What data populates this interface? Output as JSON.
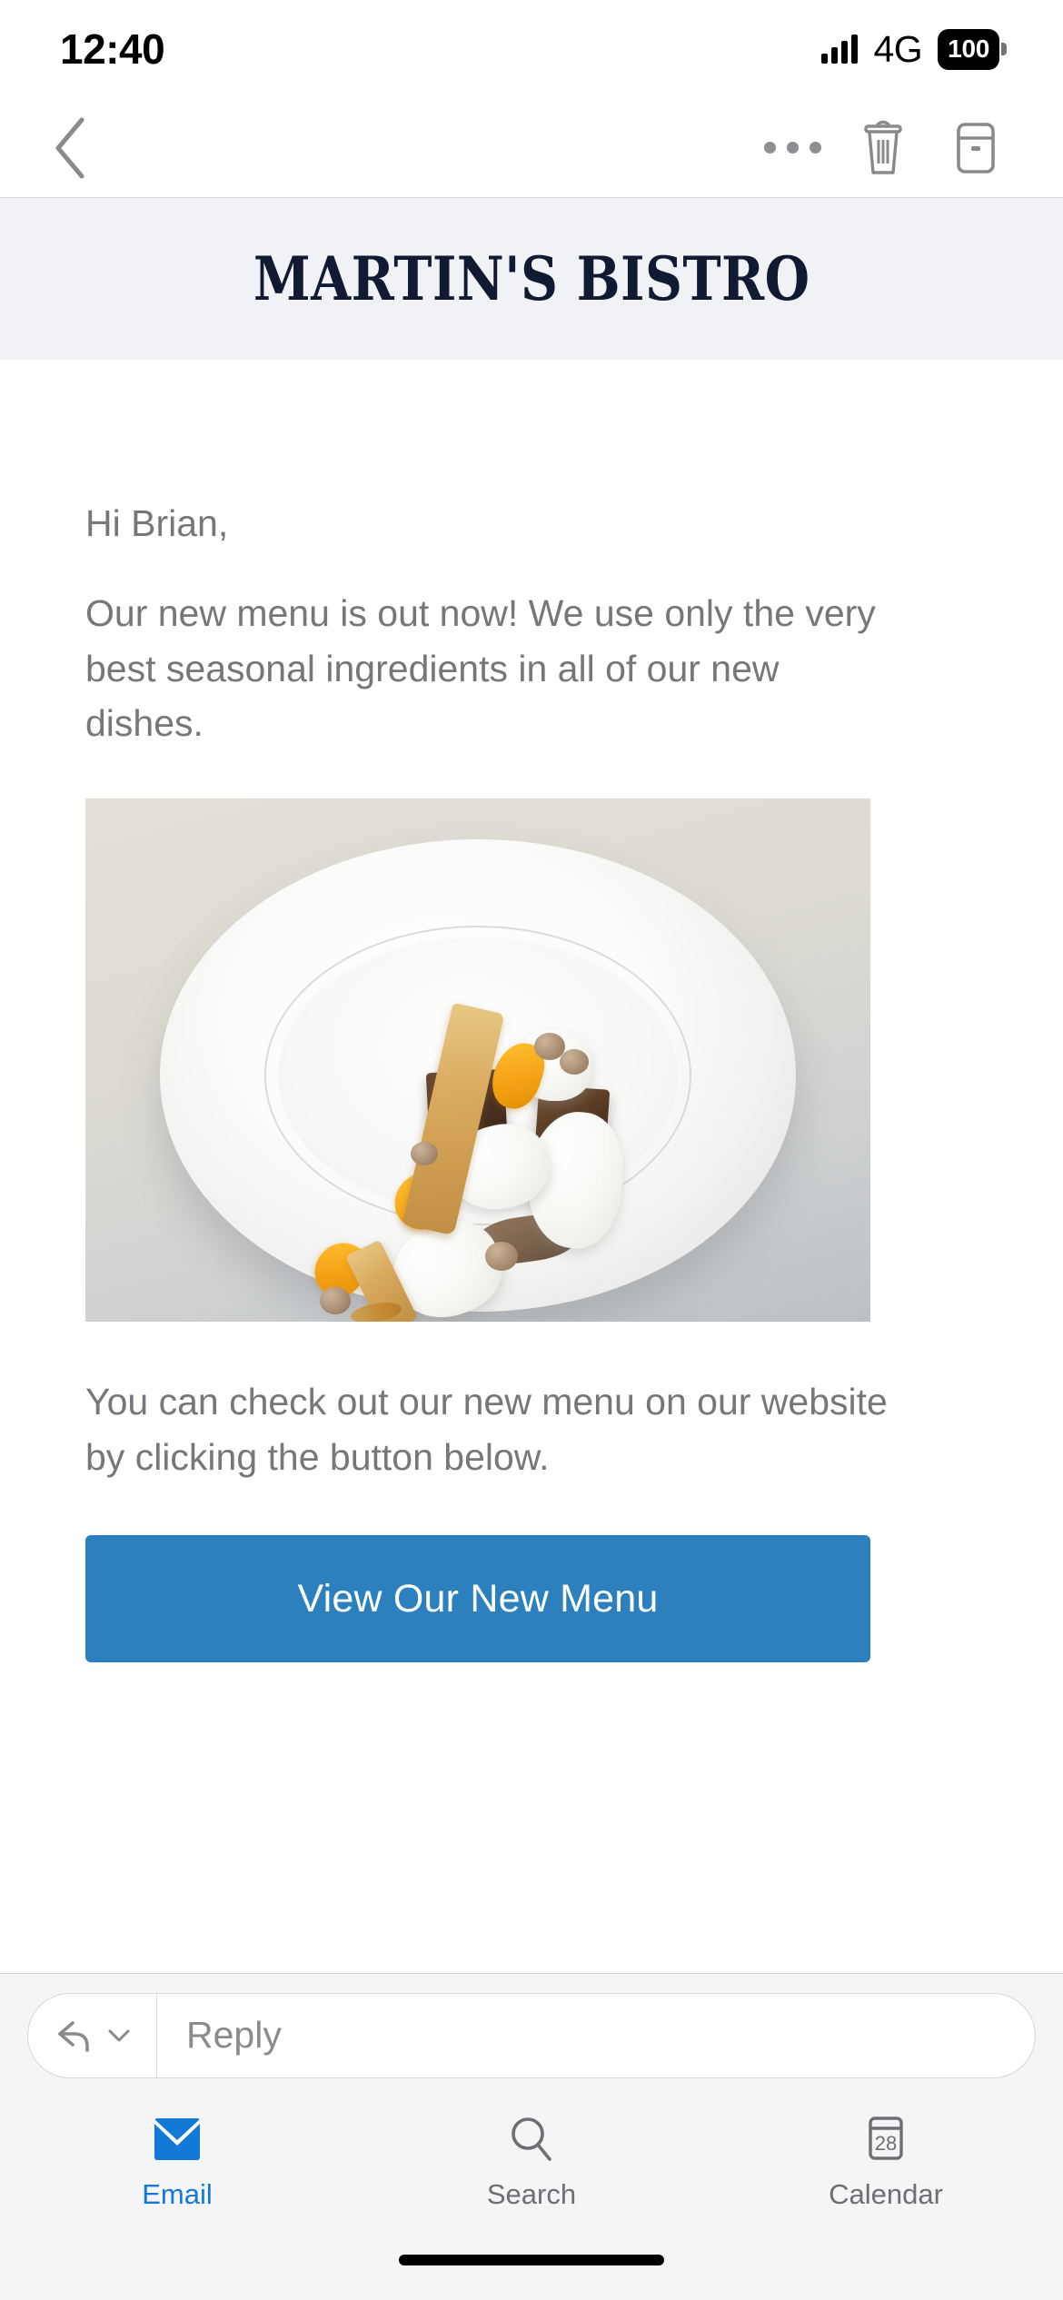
{
  "status_bar": {
    "time": "12:40",
    "network": "4G",
    "battery": "100",
    "signal_icon": "signal-bars-icon",
    "battery_icon": "battery-full-icon"
  },
  "toolbar": {
    "back_icon": "chevron-left-icon",
    "more_icon": "more-horizontal-icon",
    "delete_icon": "trash-icon",
    "archive_icon": "archive-icon"
  },
  "email": {
    "brand_title": "MARTIN'S BISTRO",
    "brand_banner_color": "#f1f2f6",
    "brand_title_color": "#111a33",
    "greeting": "Hi Brian,",
    "paragraph_1": "Our new menu is out now! We use only the very best seasonal ingredients in all of our new dishes.",
    "paragraph_2": "You can check out our new menu on our website by clicking the button below.",
    "hero_image_alt": "plated dessert with chocolate, white ice cream quenelles, honeycomb tuile and mango",
    "cta_label": "View Our New Menu",
    "cta_color": "#2b80bd",
    "cta_text_color": "#ffffff",
    "body_text_color": "#76777b"
  },
  "reply_bar": {
    "reply_icon": "reply-arrow-icon",
    "chevron_icon": "chevron-down-icon",
    "placeholder": "Reply"
  },
  "tab_bar": {
    "active_color": "#1379d6",
    "inactive_color": "#6e6e73",
    "tabs": [
      {
        "label": "Email",
        "icon": "envelope-icon",
        "active": true
      },
      {
        "label": "Search",
        "icon": "magnifier-icon",
        "active": false
      },
      {
        "label": "Calendar",
        "icon": "calendar-icon",
        "active": false,
        "badge": "28"
      }
    ]
  }
}
